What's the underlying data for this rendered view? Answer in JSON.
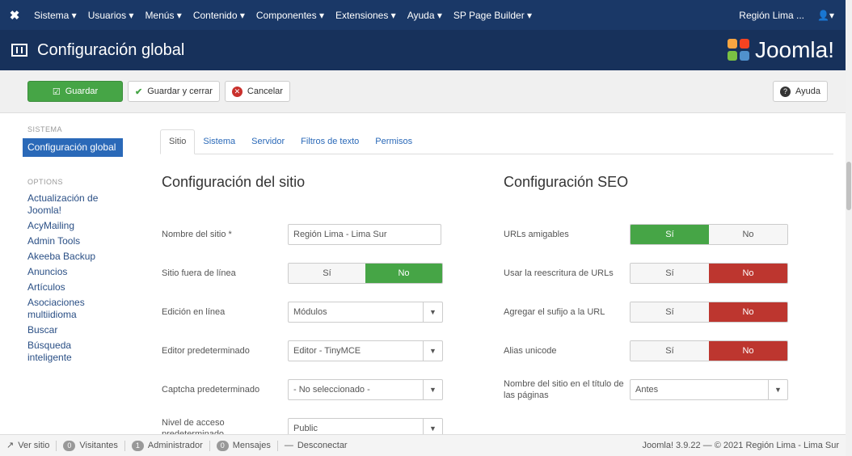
{
  "topnav": {
    "menu": [
      "Sistema ▾",
      "Usuarios ▾",
      "Menús ▾",
      "Contenido ▾",
      "Componentes ▾",
      "Extensiones ▾",
      "Ayuda ▾",
      "SP Page Builder ▾"
    ],
    "site_link": "Región Lima ...",
    "user_menu": "▾"
  },
  "titlebar": {
    "title": "Configuración global",
    "brand": "Joomla!"
  },
  "toolbar": {
    "save": "Guardar",
    "save_close": "Guardar y cerrar",
    "cancel": "Cancelar",
    "help": "Ayuda"
  },
  "sidebar": {
    "system_heading": "SISTEMA",
    "active_item": "Configuración global",
    "options_heading": "OPTIONS",
    "items": [
      "Actualización de Joomla!",
      "AcyMailing",
      "Admin Tools",
      "Akeeba Backup",
      "Anuncios",
      "Artículos",
      "Asociaciones multiidioma",
      "Buscar",
      "Búsqueda inteligente"
    ]
  },
  "tabs": [
    "Sitio",
    "Sistema",
    "Servidor",
    "Filtros de texto",
    "Permisos"
  ],
  "site_config": {
    "heading": "Configuración del sitio",
    "site_name_label": "Nombre del sitio *",
    "site_name_value": "Región Lima - Lima Sur",
    "offline_label": "Sitio fuera de línea",
    "inline_edit_label": "Edición en línea",
    "inline_edit_value": "Módulos",
    "default_editor_label": "Editor predeterminado",
    "default_editor_value": "Editor - TinyMCE",
    "default_captcha_label": "Captcha predeterminado",
    "default_captcha_value": "- No seleccionado -",
    "access_level_label": "Nivel de acceso predeterminado",
    "access_level_value": "Public"
  },
  "seo_config": {
    "heading": "Configuración SEO",
    "friendly_urls_label": "URLs amigables",
    "url_rewrite_label": "Usar la reescritura de URLs",
    "url_suffix_label": "Agregar el sufijo a la URL",
    "unicode_alias_label": "Alias unicode",
    "site_name_in_title_label": "Nombre del sitio en el título de las páginas",
    "site_name_in_title_value": "Antes"
  },
  "toggle": {
    "yes": "Sí",
    "no": "No"
  },
  "statusbar": {
    "view_site": "Ver sitio",
    "visitors_count": "0",
    "visitors": "Visitantes",
    "admins_count": "1",
    "admins": "Administrador",
    "messages_count": "0",
    "messages": "Mensajes",
    "logout": "Desconectar",
    "footer": "Joomla! 3.9.22 — © 2021 Región Lima - Lima Sur"
  },
  "colors": {
    "nav": "#1a3867",
    "accent_green": "#46a546",
    "accent_red": "#bd362f",
    "active_blue": "#2a69b8"
  }
}
